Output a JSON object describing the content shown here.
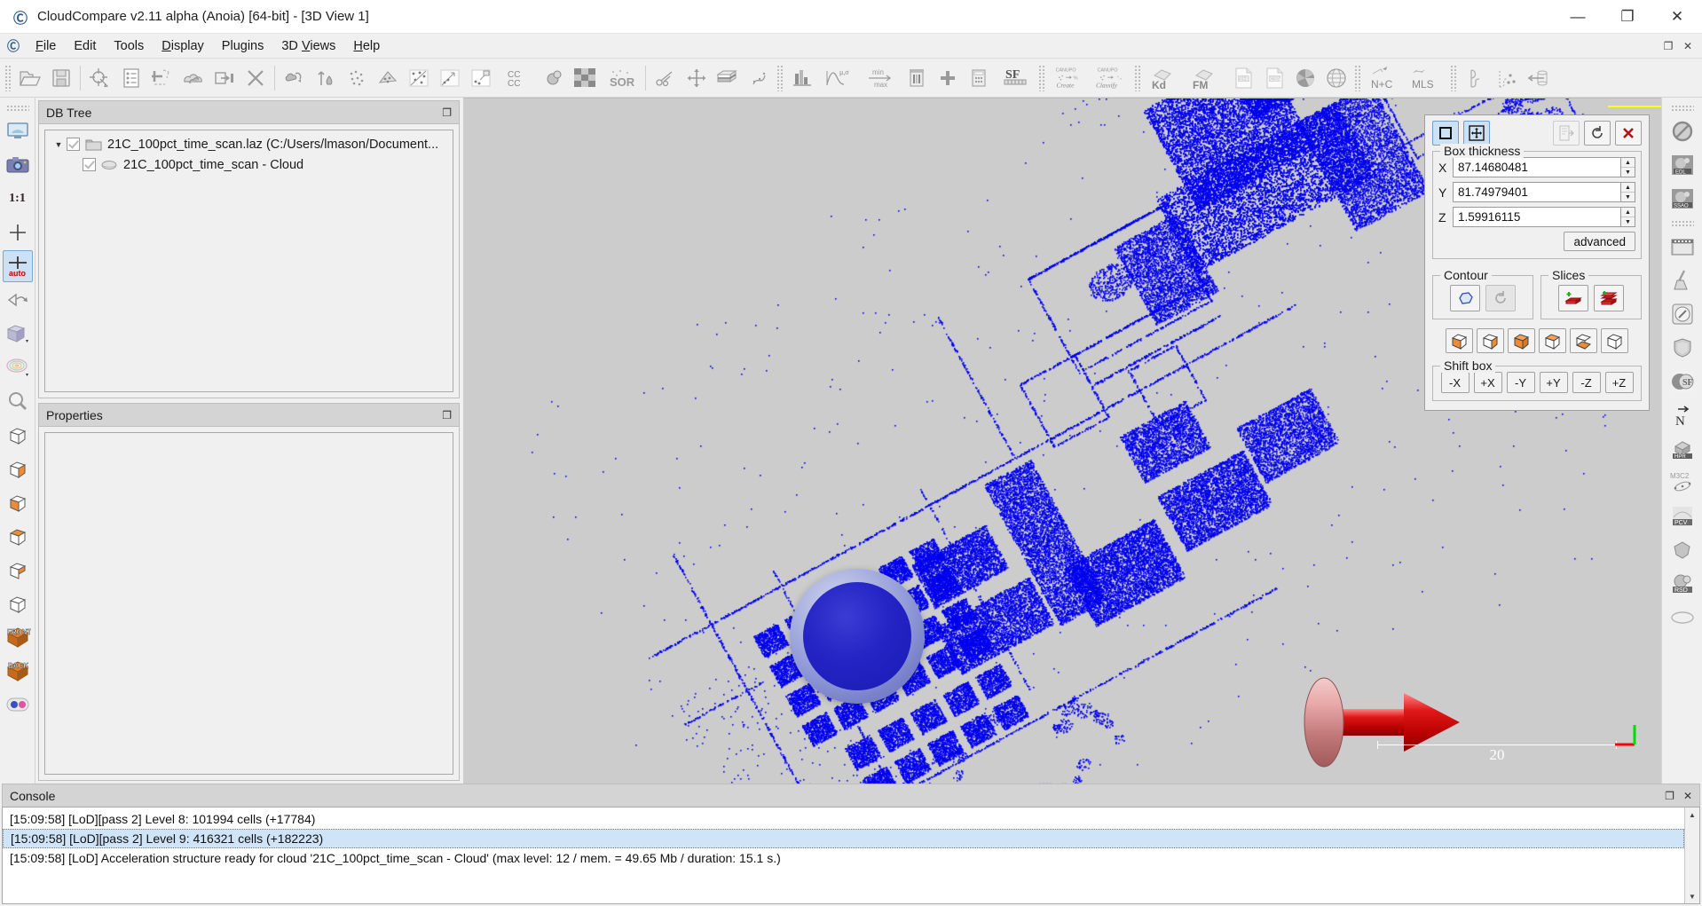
{
  "titlebar": {
    "app_icon": "cloudcompare-logo-icon",
    "title": "CloudCompare v2.11 alpha (Anoia) [64-bit] - [3D View 1]",
    "minimize": "—",
    "maximize": "❐",
    "close": "✕"
  },
  "menubar": {
    "icon": "cloudcompare-small-logo-icon",
    "items": [
      {
        "label": "File",
        "mnemonic": "F"
      },
      {
        "label": "Edit",
        "mnemonic": "E"
      },
      {
        "label": "Tools",
        "mnemonic": "T"
      },
      {
        "label": "Display",
        "mnemonic": "D"
      },
      {
        "label": "Plugins",
        "mnemonic": "P"
      },
      {
        "label": "3D Views",
        "mnemonic": "V"
      },
      {
        "label": "Help",
        "mnemonic": "H"
      }
    ],
    "mdi": {
      "restore": "❐",
      "close": "✕"
    }
  },
  "main_toolbar": {
    "groups": [
      [
        "open-file-icon",
        "save-file-icon"
      ],
      [
        "pick-point-icon",
        "properties-list-icon",
        "segment-icon",
        "clone-cloud-icon",
        "merge-icon",
        "delete-icon"
      ],
      [
        "translate-rotate-icon",
        "height-gradient-icon",
        "compute-normals-icon",
        "subsample-icon",
        "mesh-delaunay-icon",
        "match-bbox-icon",
        "register-icon",
        "align-icon",
        "cc-cc-icon",
        "cloud-cloud-dist-icon",
        "statistical-test-icon",
        "sor-filter-icon"
      ],
      [
        "scissors-icon",
        "cross-section-icon",
        "extract-section-icon",
        "fit-plane-icon"
      ],
      [
        "histogram-icon",
        "gauss-filter-icon",
        "min-max-icon",
        "delete-sf-icon",
        "add-sf-icon",
        "sf-arithmetic-icon",
        "sf-gradient-icon"
      ],
      [
        "canupo-create-icon",
        "canupo-classify-icon"
      ],
      [
        "kd-tree-icon",
        "fast-marching-icon",
        "shp-export-icon",
        "csv-export-icon",
        "pie-icon",
        "globe-icon"
      ],
      [
        "normals-plus-c-icon",
        "mls-icon"
      ],
      [
        "curvature-icon",
        "curvature-points-icon",
        "cylinder-fit-icon"
      ]
    ],
    "canupo_create_label_top": "CANUPO",
    "canupo_create_label_bottom": "Create",
    "canupo_classify_label_top": "CANUPO",
    "canupo_classify_label_bottom": "Classify",
    "kd_label": "Kd",
    "fm_label": "FM",
    "shp_label": "SHP",
    "csv_label": "CSV",
    "nc_label": "N+C",
    "mls_label": "MLS",
    "sf_label": "SF"
  },
  "left_toolbar": {
    "items": [
      {
        "name": "fullscreen-view-icon",
        "active": false
      },
      {
        "name": "snapshot-camera-icon",
        "active": false
      },
      {
        "name": "zoom-1-1-icon",
        "label": "1:1",
        "active": false
      },
      {
        "name": "center-pivot-icon",
        "active": false
      },
      {
        "name": "auto-pivot-icon",
        "label": "auto",
        "active": true
      },
      {
        "name": "rotate-view-icon",
        "active": false
      },
      {
        "name": "display-mode-icon",
        "active": false
      },
      {
        "name": "color-scale-icon",
        "active": false
      },
      {
        "name": "zoom-global-icon",
        "active": false
      },
      {
        "name": "view-iso-icon",
        "active": false
      },
      {
        "name": "view-top-icon",
        "active": false
      },
      {
        "name": "view-left-icon",
        "active": false
      },
      {
        "name": "view-bottom-icon",
        "active": false
      },
      {
        "name": "view-right-icon",
        "active": false
      },
      {
        "name": "view-iso2-icon",
        "active": false
      },
      {
        "name": "view-front-icon",
        "label": "FRONT",
        "active": false
      },
      {
        "name": "view-back-icon",
        "label": "BACK",
        "active": false
      },
      {
        "name": "stereo-mode-icon",
        "active": false
      }
    ]
  },
  "right_toolbar": {
    "items": [
      {
        "name": "no-shader-icon"
      },
      {
        "name": "edl-shader-icon",
        "label": "EDL"
      },
      {
        "name": "ssao-shader-icon",
        "label": "SSAO"
      },
      {
        "name": "animation-icon"
      },
      {
        "name": "broom-cleaning-icon"
      },
      {
        "name": "compass-icon"
      },
      {
        "name": "shield-icon"
      },
      {
        "name": "sf-plugin-icon",
        "label": "SF"
      },
      {
        "name": "normals-n-icon",
        "label": "N"
      },
      {
        "name": "hpr-icon",
        "label": "HPR"
      },
      {
        "name": "m3c2-icon",
        "label": "M3C2"
      },
      {
        "name": "pcv-icon",
        "label": "PCV"
      },
      {
        "name": "poisson-recon-icon"
      },
      {
        "name": "rsd-icon",
        "label": "RSD"
      },
      {
        "name": "ransac-sd-icon"
      }
    ]
  },
  "db_tree": {
    "title": "DB Tree",
    "float_button": "undock-icon",
    "nodes": [
      {
        "label": "21C_100pct_time_scan.laz (C:/Users/lmason/Document...",
        "icon": "folder-icon",
        "checked": true,
        "expanded": true,
        "level": 0
      },
      {
        "label": "21C_100pct_time_scan - Cloud",
        "icon": "point-cloud-icon",
        "checked": true,
        "level": 1
      }
    ]
  },
  "properties": {
    "title": "Properties",
    "float_button": "undock-icon",
    "content": ""
  },
  "cross_section": {
    "toggle_box_icon": "box-select-icon",
    "toggle_move_icon": "move-box-icon",
    "export_icon": "export-section-icon",
    "reset_icon": "restore-icon",
    "close_icon": "close-red-x-icon",
    "box_thickness": {
      "title": "Box thickness",
      "x_label": "X",
      "x_value": "87.14680481",
      "y_label": "Y",
      "y_value": "81.74979401",
      "z_label": "Z",
      "z_value": "1.59916115",
      "advanced_label": "advanced"
    },
    "contour": {
      "title": "Contour",
      "buttons": [
        "extract-contour-icon",
        "remove-contour-icon"
      ]
    },
    "slices": {
      "title": "Slices",
      "buttons": [
        "export-slice-icon",
        "export-multi-slice-icon"
      ]
    },
    "cube_buttons": [
      "cube-face-left-icon",
      "cube-face-right-icon",
      "cube-face-front-icon",
      "cube-face-top-icon",
      "cube-face-bottom-icon",
      "cube-face-back-icon"
    ],
    "shift_box": {
      "title": "Shift box",
      "buttons": [
        "-X",
        "+X",
        "-Y",
        "+Y",
        "-Z",
        "+Z"
      ]
    }
  },
  "viewport": {
    "scale_bar_label": "20",
    "cloud_color": "#0000ee",
    "background_color": "#cccccc",
    "clip_line_color": "#ffff00",
    "axis_x_color": "#ff0000",
    "axis_y_color": "#00dd00"
  },
  "console": {
    "title": "Console",
    "float_button": "undock-icon",
    "close_button": "close-icon",
    "lines": [
      {
        "text": "[15:09:58] [LoD][pass 2] Level 8: 101994 cells (+17784)",
        "selected": false
      },
      {
        "text": "[15:09:58] [LoD][pass 2] Level 9: 416321 cells (+182223)",
        "selected": true
      },
      {
        "text": "[15:09:58] [LoD] Acceleration structure ready for cloud '21C_100pct_time_scan - Cloud' (max level: 12 / mem. = 49.65 Mb / duration: 15.1 s.)",
        "selected": false
      }
    ],
    "scroll_up": "▲",
    "scroll_down": "▼"
  }
}
